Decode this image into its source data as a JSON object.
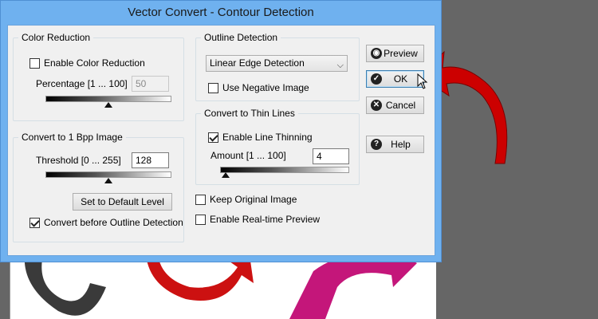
{
  "window": {
    "title": "Vector Convert - Contour Detection"
  },
  "color_reduction": {
    "title": "Color Reduction",
    "enable_label": "Enable Color Reduction",
    "enable_checked": false,
    "percentage_label": "Percentage [1 ... 100]",
    "percentage_value": "50",
    "slider_level": 0.5
  },
  "convert_1bpp": {
    "title": "Convert to 1 Bpp Image",
    "threshold_label": "Threshold [0 ... 255]",
    "threshold_value": "128",
    "slider_level": 0.5,
    "default_button": "Set to Default Level",
    "convert_before_label": "Convert before Outline Detection",
    "convert_before_checked": true
  },
  "outline_detection": {
    "title": "Outline Detection",
    "selected": "Linear Edge Detection",
    "negative_label": "Use Negative Image",
    "negative_checked": false
  },
  "thin_lines": {
    "title": "Convert to Thin Lines",
    "enable_label": "Enable Line Thinning",
    "enable_checked": true,
    "amount_label": "Amount [1 ... 100]",
    "amount_value": "4",
    "slider_level": 0.04
  },
  "options": {
    "keep_original_label": "Keep Original Image",
    "keep_original_checked": false,
    "realtime_label": "Enable Real-time Preview",
    "realtime_checked": false
  },
  "buttons": {
    "preview": "Preview",
    "ok": "OK",
    "cancel": "Cancel",
    "help": "Help"
  },
  "icons": {
    "preview": "eye-icon",
    "ok": "checkmark-icon",
    "cancel": "close-icon",
    "help": "question-icon"
  },
  "colors": {
    "title_bar": "#6fb1ef",
    "dialog_bg": "#f0f0f0",
    "red_arrow": "#cc0000",
    "background": "#666666"
  }
}
